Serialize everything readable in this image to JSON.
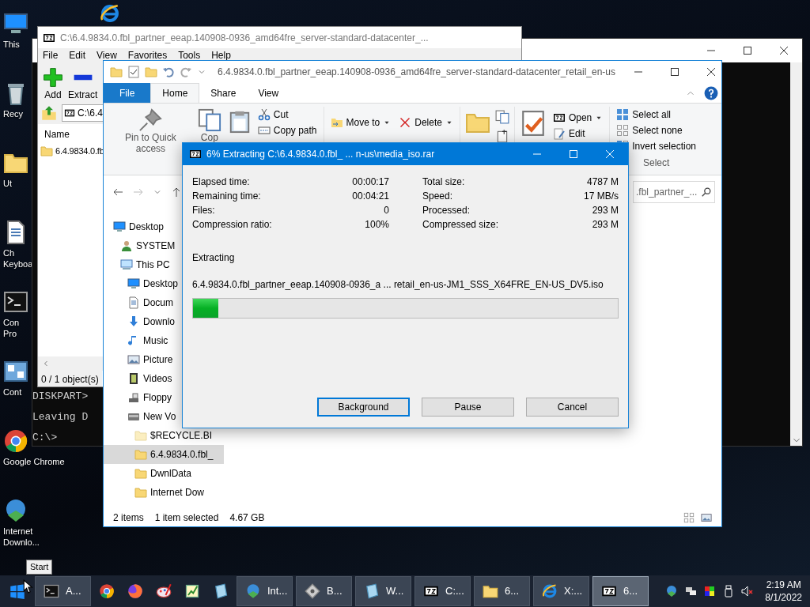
{
  "desktop_icons": [
    {
      "kind": "monitor",
      "lines": [
        "This"
      ]
    },
    {
      "kind": "trash",
      "lines": [
        "Recy"
      ]
    },
    {
      "kind": "folder",
      "lines": [
        "Ut"
      ]
    },
    {
      "kind": "document",
      "lines": [
        "Ch",
        "Keyboa"
      ]
    },
    {
      "kind": "terminal",
      "lines": [
        "Con",
        "Pro"
      ]
    },
    {
      "kind": "control",
      "lines": [
        "Cont"
      ]
    },
    {
      "kind": "browser",
      "lines": [
        "Google Chrome"
      ]
    },
    {
      "kind": "globe",
      "lines": [
        "Internet",
        "Downlo..."
      ]
    }
  ],
  "console": {
    "lines": [
      "DISKPART>",
      "Leaving D",
      "C:\\>"
    ]
  },
  "sevenzip": {
    "title": "C:\\6.4.9834.0.fbl_partner_eeap.140908-0936_amd64fre_server-standard-datacenter_...",
    "menu": [
      "File",
      "Edit",
      "View",
      "Favorites",
      "Tools",
      "Help"
    ],
    "tools": [
      {
        "kind": "plus",
        "label": "Add"
      },
      {
        "kind": "minus",
        "label": "Extract"
      }
    ],
    "address": "C:\\6.4",
    "column": "Name",
    "rows": [
      "6.4.9834.0.fb"
    ],
    "status": "0 / 1 object(s)"
  },
  "explorer": {
    "title": "6.4.9834.0.fbl_partner_eeap.140908-0936_amd64fre_server-standard-datacenter_retail_en-us",
    "tabs": [
      {
        "label": "File",
        "kind": "file",
        "selected": false
      },
      {
        "label": "Home",
        "kind": "tab",
        "selected": true
      },
      {
        "label": "Share",
        "kind": "tab",
        "selected": false
      },
      {
        "label": "View",
        "kind": "tab",
        "selected": false
      }
    ],
    "ribbon": {
      "pin": "Pin to Quick access",
      "copy": "Cop",
      "cut": "Cut",
      "copy_path": "Copy path",
      "move_to": "Move to",
      "delete": "Delete",
      "open": "Open",
      "edit": "Edit",
      "select_all": "Select all",
      "select_none": "Select none",
      "invert_selection": "Invert selection",
      "select_group": "Select"
    },
    "search": {
      "placeholder": ".fbl_partner_..."
    },
    "tree": [
      {
        "label": "Desktop",
        "kind": "monitor",
        "selected": false,
        "children": [
          {
            "label": "SYSTEM",
            "kind": "user",
            "selected": false
          },
          {
            "label": "This PC",
            "kind": "pc",
            "selected": false,
            "children": [
              {
                "label": "Desktop",
                "kind": "monitor",
                "selected": false
              },
              {
                "label": "Docum",
                "kind": "document",
                "selected": false
              },
              {
                "label": "Downlo",
                "kind": "download",
                "selected": false
              },
              {
                "label": "Music",
                "kind": "music",
                "selected": false
              },
              {
                "label": "Picture",
                "kind": "picture",
                "selected": false
              },
              {
                "label": "Videos",
                "kind": "film",
                "selected": false
              },
              {
                "label": "Floppy",
                "kind": "floppy",
                "selected": false
              },
              {
                "label": "New Vo",
                "kind": "drive",
                "selected": false,
                "children": [
                  {
                    "label": "$RECYCLE.BI",
                    "kind": "folder-pale",
                    "selected": false
                  },
                  {
                    "label": "6.4.9834.0.fbl_",
                    "kind": "folder",
                    "selected": true
                  },
                  {
                    "label": "DwnlData",
                    "kind": "folder",
                    "selected": false
                  },
                  {
                    "label": "Internet Dow",
                    "kind": "folder",
                    "selected": false
                  }
                ]
              }
            ]
          }
        ]
      }
    ],
    "status": [
      "2 items",
      "1 item selected",
      "4.67 GB"
    ]
  },
  "dialog": {
    "title": "6% Extracting C:\\6.4.9834.0.fbl_ ... n-us\\media_iso.rar",
    "stats_left": [
      {
        "label": "Elapsed time:",
        "value": "00:00:17"
      },
      {
        "label": "Remaining time:",
        "value": "00:04:21"
      },
      {
        "label": "Files:",
        "value": "0"
      },
      {
        "label": "Compression ratio:",
        "value": "100%"
      }
    ],
    "stats_right": [
      {
        "label": "Total size:",
        "value": "4787 M"
      },
      {
        "label": "Speed:",
        "value": "17 MB/s"
      },
      {
        "label": "Processed:",
        "value": "293 M"
      },
      {
        "label": "Compressed size:",
        "value": "293 M"
      }
    ],
    "action": "Extracting",
    "file": "6.4.9834.0.fbl_partner_eeap.140908-0936_a ... retail_en-us-JM1_SSS_X64FRE_EN-US_DV5.iso",
    "progress": {
      "level": 0.06
    },
    "buttons": [
      {
        "label": "Background",
        "selected": true
      },
      {
        "label": "Pause",
        "selected": false
      },
      {
        "label": "Cancel",
        "selected": false
      }
    ]
  },
  "taskbar": {
    "start_tooltip": "Start",
    "items": [
      {
        "kind": "terminal",
        "label": "A...",
        "selected": false
      },
      {
        "kind": "browser",
        "selected": false
      },
      {
        "kind": "fox",
        "selected": false
      },
      {
        "kind": "palette",
        "selected": false
      },
      {
        "kind": "chart",
        "selected": false
      },
      {
        "kind": "notebook",
        "selected": false
      },
      {
        "kind": "globe",
        "label": "Int...",
        "selected": false
      },
      {
        "kind": "disk",
        "label": "B...",
        "selected": false
      },
      {
        "kind": "notebook",
        "label": "W...",
        "selected": false
      },
      {
        "kind": "archive",
        "label": "C:...",
        "selected": false
      },
      {
        "kind": "folder",
        "label": "6...",
        "selected": false
      },
      {
        "kind": "ie",
        "label": "X:...",
        "selected": false
      },
      {
        "kind": "archive",
        "label": "6...",
        "selected": true
      }
    ],
    "clock": {
      "time": "2:19 AM",
      "date": "8/1/2022"
    }
  }
}
